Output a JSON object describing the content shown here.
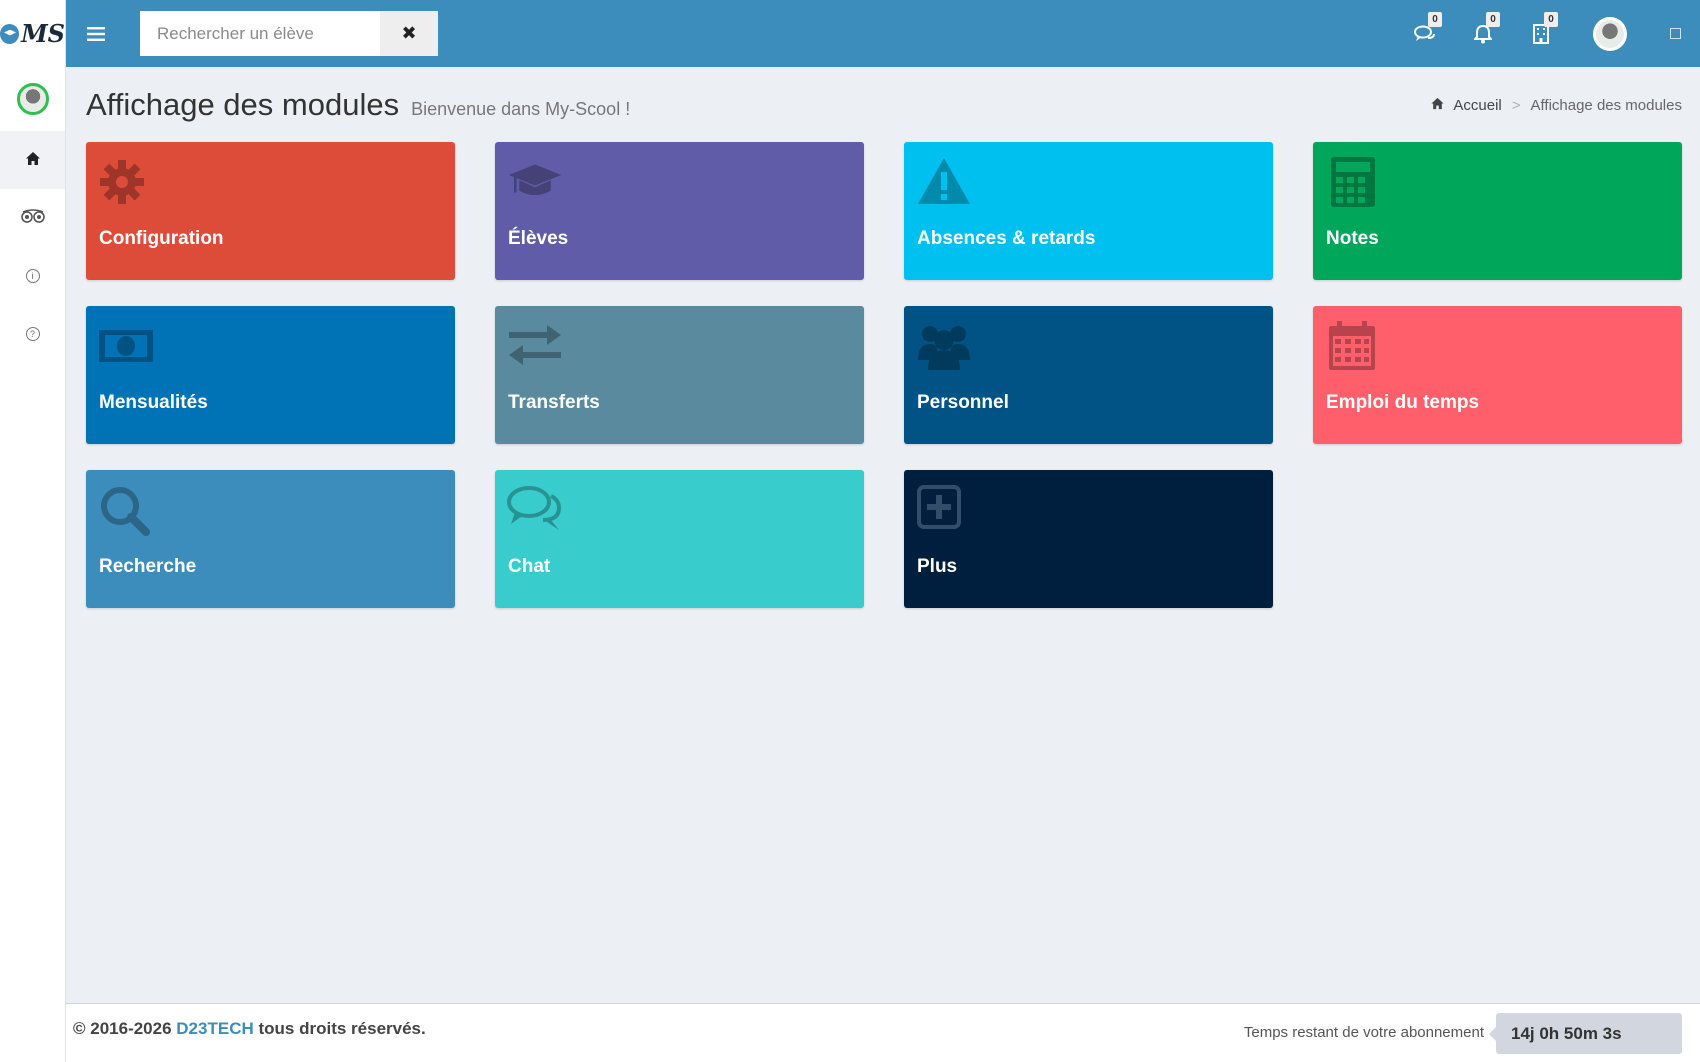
{
  "logo": {
    "text": "MS"
  },
  "search": {
    "placeholder": "Rechercher un élève",
    "value": "",
    "clear_label": "✖"
  },
  "nav": {
    "messages_count": "0",
    "notifications_count": "0",
    "tasks_count": "0"
  },
  "header": {
    "title": "Affichage des modules",
    "subtitle": "Bienvenue dans My-Scool !"
  },
  "breadcrumb": {
    "home": "Accueil",
    "separator": ">",
    "current": "Affichage des modules"
  },
  "modules": [
    {
      "label": "Configuration",
      "color": "#dd4b39",
      "icon": "gear-icon"
    },
    {
      "label": "Élèves",
      "color": "#605ca8",
      "icon": "graduation-cap-icon"
    },
    {
      "label": "Absences & retards",
      "color": "#00c0ef",
      "icon": "warning-icon"
    },
    {
      "label": "Notes",
      "color": "#00a65a",
      "icon": "calculator-icon"
    },
    {
      "label": "Mensualités",
      "color": "#0073b7",
      "icon": "money-icon"
    },
    {
      "label": "Transferts",
      "color": "#5a8a9e",
      "icon": "exchange-icon"
    },
    {
      "label": "Personnel",
      "color": "#005384",
      "icon": "users-icon"
    },
    {
      "label": "Emploi du temps",
      "color": "#ff5f6b",
      "icon": "calendar-icon"
    },
    {
      "label": "Recherche",
      "color": "#3c8dbc",
      "icon": "search-icon"
    },
    {
      "label": "Chat",
      "color": "#39cccc",
      "icon": "comments-icon"
    },
    {
      "label": "Plus",
      "color": "#001f3f",
      "icon": "plus-square-icon"
    }
  ],
  "footer": {
    "copyright_prefix": "© 2016-2026",
    "brand": "D23TECH",
    "copyright_suffix": "tous droits réservés.",
    "subscription_label": "Temps restant de votre abonnement",
    "subscription_time": "14j 0h 50m 3s"
  }
}
